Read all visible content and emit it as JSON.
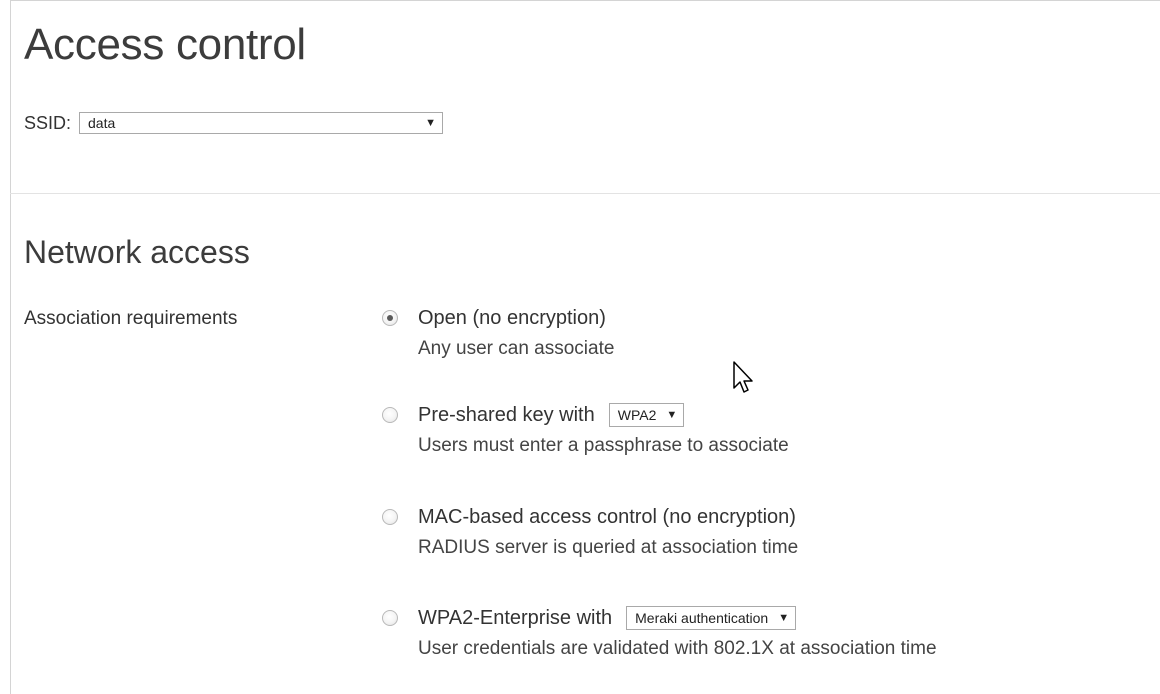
{
  "page": {
    "title": "Access control"
  },
  "ssid": {
    "label": "SSID:",
    "selected": "data"
  },
  "network_access": {
    "section_title": "Network access",
    "association_label": "Association requirements",
    "options": [
      {
        "label": "Open (no encryption)",
        "description": "Any user can associate",
        "selected": true
      },
      {
        "label": "Pre-shared key with",
        "select_value": "WPA2",
        "description": "Users must enter a passphrase to associate",
        "selected": false
      },
      {
        "label": "MAC-based access control (no encryption)",
        "description": "RADIUS server is queried at association time",
        "selected": false
      },
      {
        "label": "WPA2-Enterprise with",
        "select_value": "Meraki authentication",
        "description": "User credentials are validated with 802.1X at association time",
        "selected": false
      }
    ]
  },
  "icons": {
    "dropdown_arrow": "chevron-down-icon",
    "radio_selected": "radio-selected-icon",
    "radio_unselected": "radio-unselected-icon",
    "cursor": "mouse-pointer-icon"
  }
}
